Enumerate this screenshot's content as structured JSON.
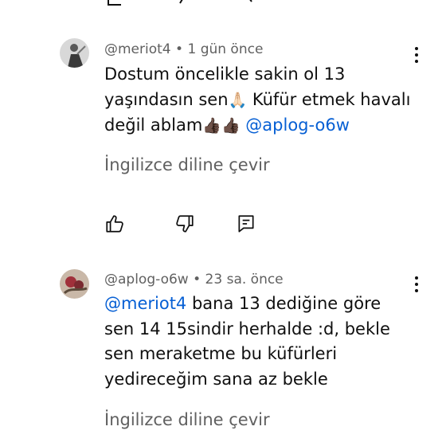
{
  "comments": [
    {
      "handle": "@meriot4",
      "age": "1 gün önce",
      "line1": "Dostum öncelikle sakin ol 13",
      "line2": "yaşındasın sen",
      "line2_emoji": "🙏🏻",
      "line2_rest": " Küfür etmek havalı",
      "line3": "değil ablam",
      "line3_emoji": "👍🏿👍🏿",
      "line3_mention": " @aplog-o6w",
      "translate": "İngilizce diline çevir"
    },
    {
      "handle": "@aplog-o6w",
      "age": "23 sa. önce",
      "mention": " @meriot4",
      "line1_rest": " bana 13 dediğine göre",
      "line2": "sen 14 15sindir herhalde :d, bekle",
      "line3": "sen meraketme bu küfürleri",
      "line4": "yedireceğim sana az bekle",
      "translate": "İngilizce diline çevir"
    }
  ],
  "separator": " • ",
  "icons": [
    "like-icon",
    "dislike-icon",
    "reply-icon",
    "more-vert-icon"
  ],
  "colors": {
    "mention": "#065fd4",
    "secondary_text": "#606060",
    "primary_text": "#0f0f0f"
  }
}
